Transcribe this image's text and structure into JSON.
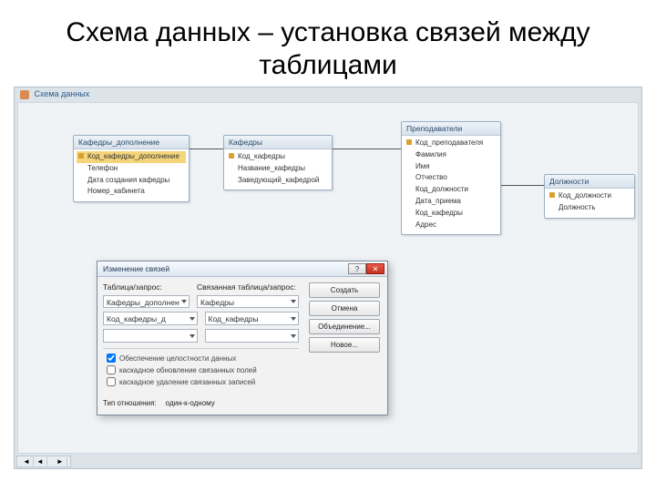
{
  "slide_title": "Схема данных – установка связей между таблицами",
  "workspace_title": "Схема данных",
  "tables": {
    "t1": {
      "title": "Кафедры_дополнение",
      "fields": [
        "Код_кафедры_дополнение",
        "Телефон",
        "Дата создания кафедры",
        "Номер_кабинета"
      ]
    },
    "t2": {
      "title": "Кафедры",
      "fields": [
        "Код_кафедры",
        "Название_кафедры",
        "Заведующий_кафедрой"
      ]
    },
    "t3": {
      "title": "Преподаватели",
      "fields": [
        "Код_преподавателя",
        "Фамилия",
        "Имя",
        "Отчество",
        "Код_должности",
        "Дата_приема",
        "Код_кафедры",
        "Адрес"
      ]
    },
    "t4": {
      "title": "Должности",
      "fields": [
        "Код_должности",
        "Должность"
      ]
    }
  },
  "dialog": {
    "title": "Изменение связей",
    "labels": {
      "table_query": "Таблица/запрос:",
      "related": "Связанная таблица/запрос:"
    },
    "left_combo": "Кафедры_дополнен",
    "right_combo": "Кафедры",
    "map_left": "Код_кафедры_д",
    "map_right": "Код_кафедры",
    "buttons": {
      "create": "Создать",
      "cancel": "Отмена",
      "join": "Объединение...",
      "new": "Новое..."
    },
    "checks": {
      "integrity": "Обеспечение целостности данных",
      "cascade_update": "каскадное обновление связанных полей",
      "cascade_delete": "каскадное удаление связанных записей"
    },
    "rel_label": "Тип отношения:",
    "rel_value": "один-к-одному"
  },
  "pager": {
    "p1": "◄",
    "p2": "◄",
    "p3": " ",
    "p4": "►"
  }
}
